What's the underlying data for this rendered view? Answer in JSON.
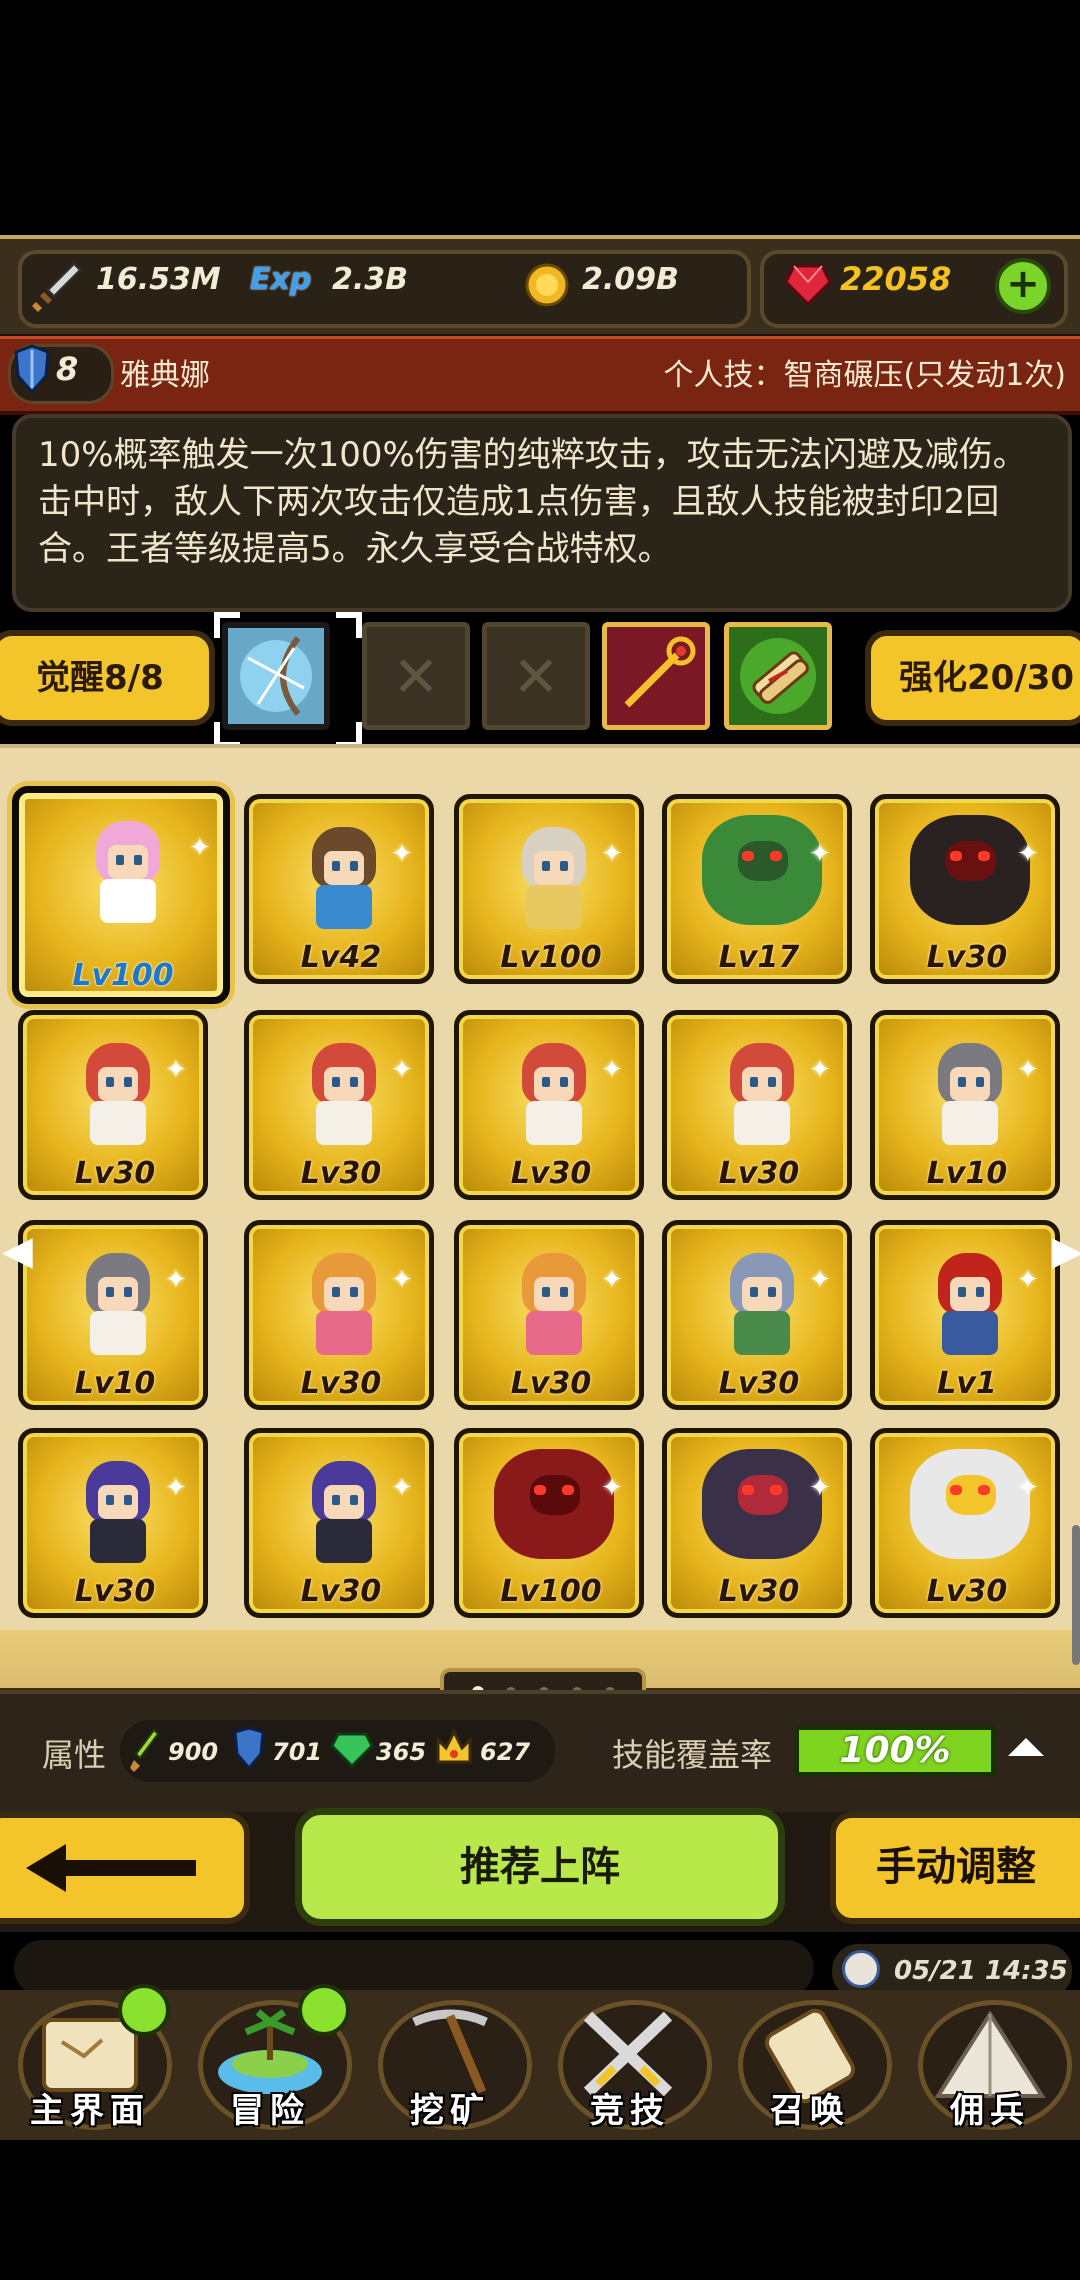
{
  "resources": {
    "attack_power": "16.53M",
    "exp_label": "Exp",
    "exp": "2.3B",
    "gold": "2.09B",
    "gems": "22058",
    "add_label": "+"
  },
  "hero": {
    "awaken_level": "8",
    "name": "雅典娜",
    "skill_title": "个人技：智商碾压(只发动1次)",
    "description": "10%概率触发一次100%伤害的纯粹攻击，攻击无法闪避及减伤。击中时，敌人下两次攻击仅造成1点伤害，且敌人技能被封印2回合。王者等级提高5。永久享受合战特权。"
  },
  "slots": {
    "awaken_label": "觉醒8/8",
    "strengthen_label": "强化20/30",
    "items": [
      "bow-and-shield",
      "empty",
      "empty",
      "golden-staff",
      "scroll-bundle"
    ]
  },
  "heroes": [
    {
      "level": "Lv100",
      "type": "pink-hair-girl",
      "selected": true
    },
    {
      "level": "Lv42",
      "type": "winged-archer"
    },
    {
      "level": "Lv100",
      "type": "priestess"
    },
    {
      "level": "Lv17",
      "type": "green-dragon"
    },
    {
      "level": "Lv30",
      "type": "black-dragon"
    },
    {
      "level": "Lv30",
      "type": "red-hair-girl"
    },
    {
      "level": "Lv30",
      "type": "red-hair-girl"
    },
    {
      "level": "Lv30",
      "type": "red-hair-girl"
    },
    {
      "level": "Lv30",
      "type": "red-hair-girl"
    },
    {
      "level": "Lv10",
      "type": "gray-hair-girl"
    },
    {
      "level": "Lv10",
      "type": "gray-hair-girl"
    },
    {
      "level": "Lv30",
      "type": "orange-hair-girl"
    },
    {
      "level": "Lv30",
      "type": "orange-hair-girl"
    },
    {
      "level": "Lv30",
      "type": "cat-warrior"
    },
    {
      "level": "Lv1",
      "type": "red-bandana-fighter"
    },
    {
      "level": "Lv30",
      "type": "purple-hair-knight"
    },
    {
      "level": "Lv30",
      "type": "purple-hair-knight"
    },
    {
      "level": "Lv100",
      "type": "red-demon"
    },
    {
      "level": "Lv30",
      "type": "dark-beast"
    },
    {
      "level": "Lv30",
      "type": "white-tiger"
    }
  ],
  "attributes": {
    "label": "属性",
    "attack": "900",
    "defense": "701",
    "gem": "365",
    "crown": "627",
    "coverage_label": "技能覆盖率",
    "coverage_value": "100%",
    "coverage": 1.0
  },
  "buttons": {
    "recommend": "推荐上阵",
    "manual": "手动调整"
  },
  "status": {
    "datetime": "05/21 14:35"
  },
  "nav": [
    {
      "label": "主界面",
      "icon": "map-scroll-icon",
      "badge": true
    },
    {
      "label": "冒险",
      "icon": "island-icon",
      "badge": true
    },
    {
      "label": "挖矿",
      "icon": "pickaxe-icon",
      "badge": false
    },
    {
      "label": "竞技",
      "icon": "crossed-swords-icon",
      "badge": false
    },
    {
      "label": "召唤",
      "icon": "summon-scroll-icon",
      "badge": false
    },
    {
      "label": "佣兵",
      "icon": "tent-icon",
      "badge": false
    }
  ],
  "colors": {
    "gold": "#f3c52a",
    "accent_green": "#b8e84a",
    "name_bar": "#7a2412",
    "gem_text": "#f5c220"
  }
}
